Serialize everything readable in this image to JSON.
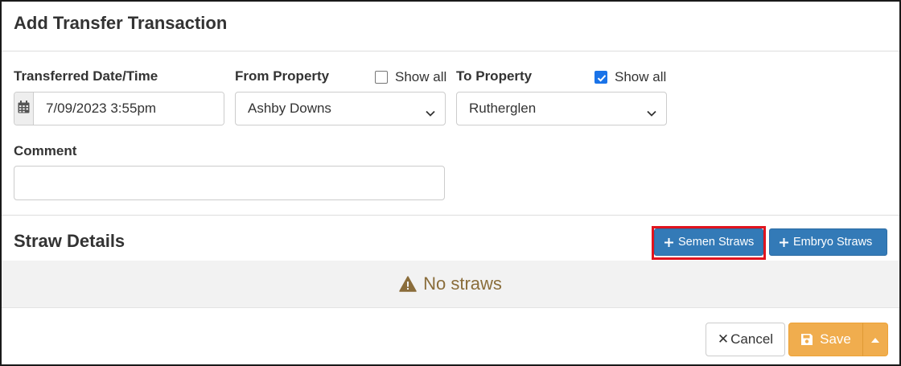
{
  "dialog": {
    "title": "Add Transfer Transaction"
  },
  "form": {
    "transferred_label": "Transferred Date/Time",
    "transferred_value": "7/09/2023 3:55pm",
    "from_label": "From Property",
    "from_show_all_label": "Show all",
    "from_show_all_checked": false,
    "from_value": "Ashby Downs",
    "to_label": "To Property",
    "to_show_all_label": "Show all",
    "to_show_all_checked": true,
    "to_value": "Rutherglen",
    "comment_label": "Comment",
    "comment_value": ""
  },
  "straws": {
    "title": "Straw Details",
    "semen_button": "Semen Straws",
    "embryo_button": "Embryo Straws",
    "empty_message": "No straws"
  },
  "footer": {
    "cancel_label": "Cancel",
    "save_label": "Save"
  },
  "colors": {
    "primary": "#337ab7",
    "warning": "#f0ad4e",
    "empty_text": "#8a6d3b",
    "highlight": "#e0141e",
    "checkbox_checked": "#1a73e8"
  },
  "icons": [
    "calendar-icon",
    "chevron-down-icon",
    "plus-icon",
    "warning-icon",
    "close-icon",
    "save-icon",
    "caret-up-icon",
    "check-icon"
  ]
}
